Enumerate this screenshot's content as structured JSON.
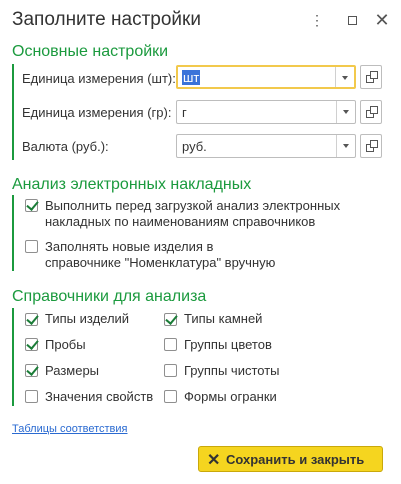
{
  "window": {
    "title": "Заполните настройки",
    "menu_icon": "kebab-menu-icon",
    "maximize_icon": "maximize-icon",
    "close_icon": "close-icon"
  },
  "main_settings": {
    "title": "Основные настройки",
    "fields": [
      {
        "label": "Единица измерения (шт):",
        "value": "шт",
        "focused": true
      },
      {
        "label": "Единица измерения (гр):",
        "value": "г",
        "focused": false
      },
      {
        "label": "Валюта (руб.):",
        "value": "руб.",
        "focused": false
      }
    ]
  },
  "invoice_analysis": {
    "title": "Анализ электронных накладных",
    "options": [
      {
        "line1": "Выполнить перед загрузкой анализ электронных",
        "line2": "накладных по наименованиям справочников",
        "checked": true
      },
      {
        "line1": "Заполнять новые изделия в",
        "line2": "справочнике \"Номенклатура\" вручную",
        "checked": false
      }
    ]
  },
  "catalogs": {
    "title": "Справочники для анализа",
    "left": [
      {
        "label": "Типы изделий",
        "checked": true
      },
      {
        "label": "Пробы",
        "checked": true
      },
      {
        "label": "Размеры",
        "checked": true
      },
      {
        "label": "Значения свойств",
        "checked": false
      }
    ],
    "right": [
      {
        "label": "Типы камней",
        "checked": true
      },
      {
        "label": "Группы цветов",
        "checked": false
      },
      {
        "label": "Группы чистоты",
        "checked": false
      },
      {
        "label": "Формы огранки",
        "checked": false
      }
    ]
  },
  "footer": {
    "link": "Таблицы соответствия",
    "save_button": "Сохранить и закрыть",
    "save_icon": "close-x-icon"
  },
  "colors": {
    "accent_green": "#1b9a3e",
    "button_yellow": "#f5d51f",
    "focus_yellow": "#f2c94c",
    "link_blue": "#2a6ad1",
    "selection_blue": "#3a73d9"
  }
}
